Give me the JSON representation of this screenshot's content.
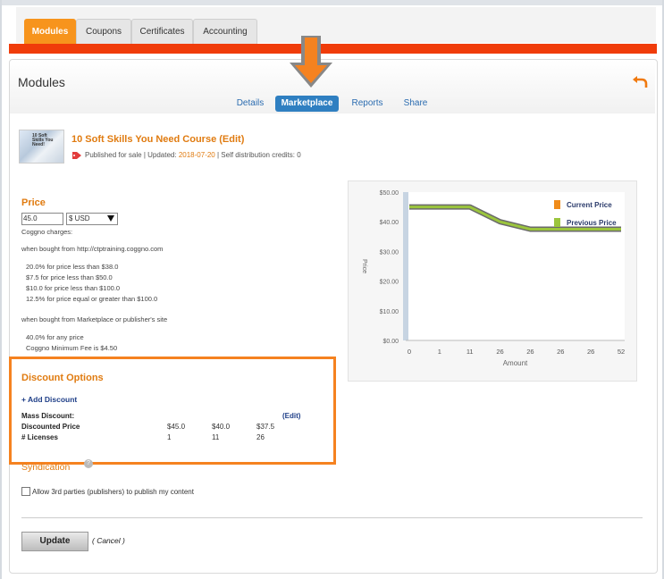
{
  "top_tabs": [
    {
      "label": "Modules",
      "active": true
    },
    {
      "label": "Coupons",
      "active": false
    },
    {
      "label": "Certificates",
      "active": false
    },
    {
      "label": "Accounting",
      "active": false
    }
  ],
  "panel": {
    "title": "Modules",
    "subtabs": [
      {
        "label": "Details",
        "active": false
      },
      {
        "label": "Marketplace",
        "active": true
      },
      {
        "label": "Reports",
        "active": false
      },
      {
        "label": "Share",
        "active": false
      }
    ]
  },
  "course": {
    "thumb_text": "10 Soft Skills You Need!",
    "title": "10 Soft Skills You Need Course (Edit)",
    "published_text": "Published for sale | Updated:",
    "updated_date": "2018-07-20",
    "credits_text": "| Self distribution credits: 0"
  },
  "price": {
    "title": "Price",
    "value": "45.0",
    "currency": "$ USD",
    "coggno_charges": "Coggno charges:",
    "when_site": "when bought from http://ctptraining.coggno.com",
    "site_rules": [
      "20.0% for price less than $38.0",
      "$7.5 for price less than $50.0",
      "$10.0 for price less than $100.0",
      "12.5% for price equal or greater than $100.0"
    ],
    "when_marketplace": "when bought from Marketplace or publisher's site",
    "marketplace_rules": [
      "40.0% for any price",
      "Coggno Minimum Fee is $4.50"
    ]
  },
  "discount": {
    "title": "Discount Options",
    "add_label": "+ Add Discount",
    "mass_label": "Mass Discount:",
    "edit_label": "(Edit)",
    "price_label": "Discounted Price",
    "licenses_label": "# Licenses",
    "prices": [
      "$45.0",
      "$40.0",
      "$37.5"
    ],
    "licenses": [
      "1",
      "11",
      "26"
    ]
  },
  "syndication": {
    "title": "Syndication",
    "help_icon": "?",
    "allow_label": "Allow 3rd parties (publishers) to publish my content"
  },
  "actions": {
    "update_label": "Update",
    "cancel_label": "( Cancel )"
  },
  "colors": {
    "accent": "#f7941d",
    "current_price": "#f08c1a",
    "previous_price": "#9bc53d",
    "link_blue": "#2f7fc1",
    "highlight_red": "#f03c0a"
  },
  "chart_data": {
    "type": "line",
    "ylabel": "Price",
    "xlabel": "Amount",
    "y_ticks": [
      "$50.00",
      "$40.00",
      "$30.00",
      "$20.00",
      "$10.00",
      "$0.00"
    ],
    "x_ticks": [
      "0",
      "1",
      "11",
      "26",
      "26",
      "26",
      "26",
      "52"
    ],
    "ylim": [
      0,
      50
    ],
    "legend_position": "top-right",
    "series": [
      {
        "name": "Current Price",
        "values": [
          45,
          45,
          45,
          40,
          37.5,
          37.5,
          37.5,
          37.5
        ]
      },
      {
        "name": "Previous Price",
        "values": [
          45,
          45,
          45,
          40,
          37.5,
          37.5,
          37.5,
          37.5
        ]
      }
    ]
  }
}
